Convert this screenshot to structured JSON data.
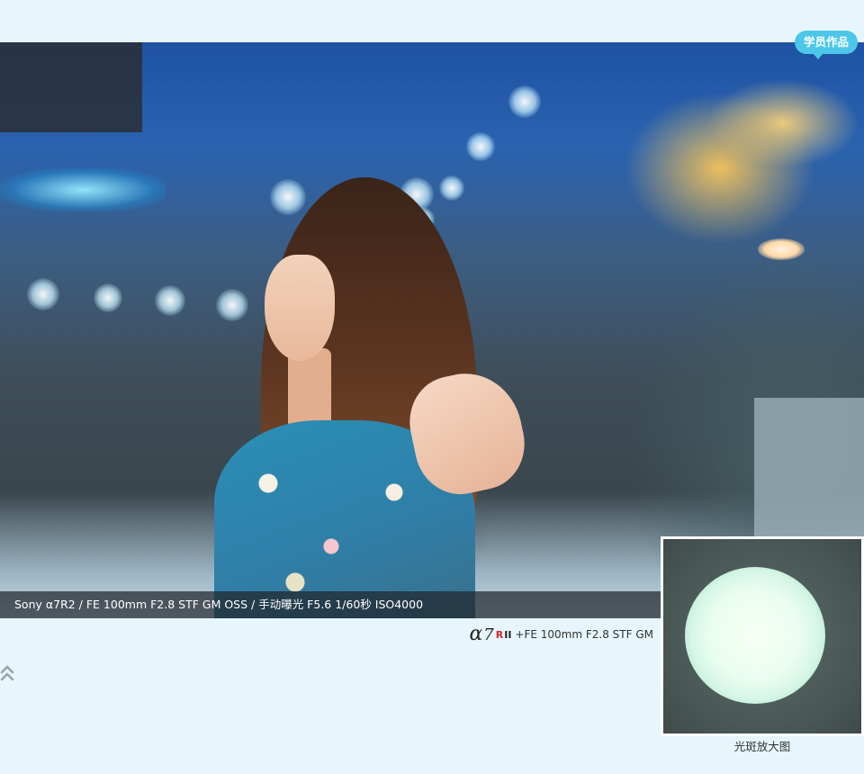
{
  "badge": {
    "label": "学员作品",
    "color": "#4cc7ea"
  },
  "photo": {
    "caption": "Sony α7R2 / FE 100mm F2.8 STF GM OSS / 手动曝光 F5.6 1/60秒 ISO4000"
  },
  "camera_logo": {
    "alpha": "α",
    "number": "7",
    "r": "R",
    "ii": "II",
    "lens": "+FE 100mm F2.8 STF GM",
    "r_color": "#d6262a"
  },
  "inset": {
    "label": "光斑放大图"
  },
  "icons": {
    "scroll_up": "double-chevron-up-icon"
  },
  "colors": {
    "page_background": "#e6f6fc"
  }
}
